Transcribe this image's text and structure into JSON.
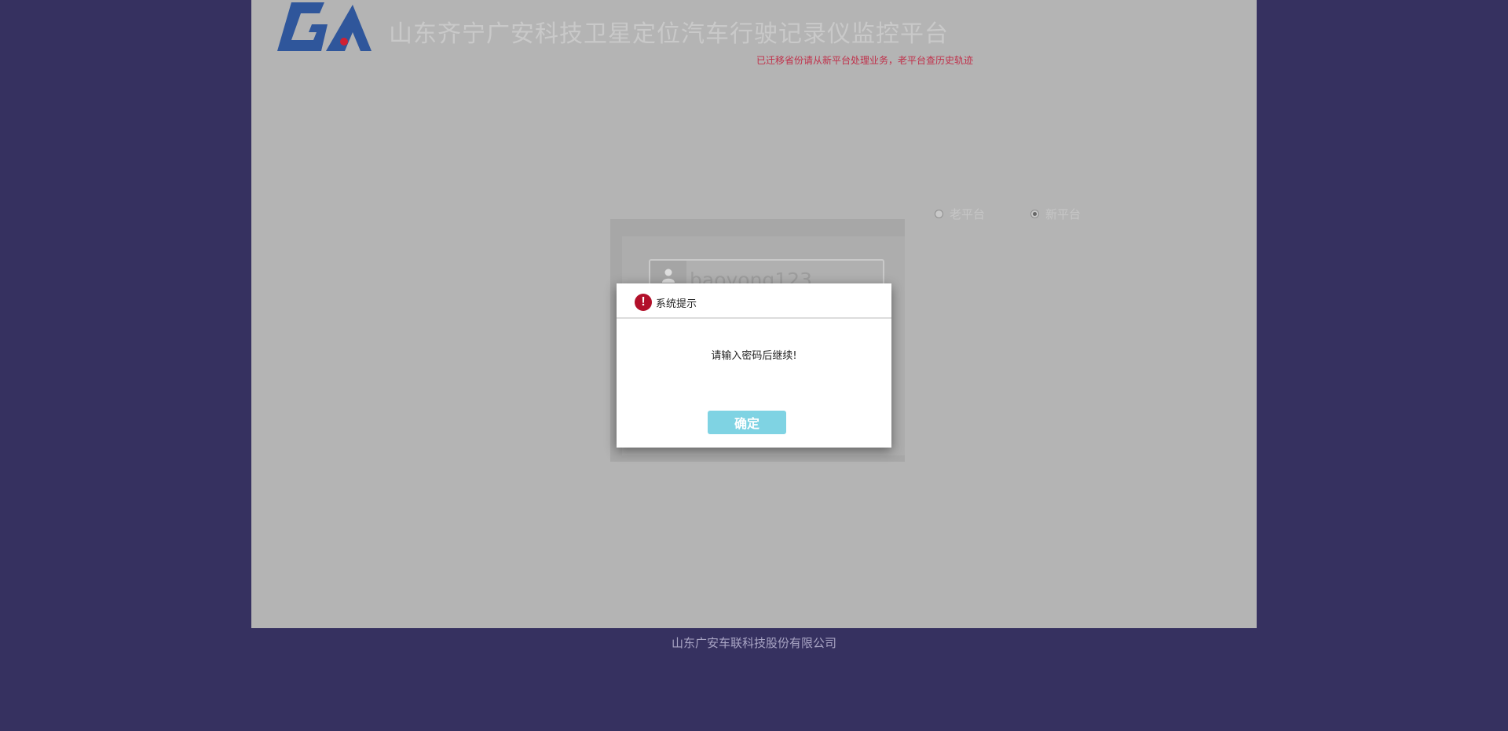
{
  "header": {
    "title": "山东齐宁广安科技卫星定位汽车行驶记录仪监控平台",
    "notice": "已迁移省份请从新平台处理业务，老平台查历史轨迹",
    "logo_icon": "ga-logo"
  },
  "platform_options": [
    {
      "label": "老平台",
      "checked": false
    },
    {
      "label": "新平台",
      "checked": true
    }
  ],
  "login": {
    "username_value": "baoyong123",
    "user_icon": "user-icon"
  },
  "dialog": {
    "title": "系统提示",
    "message": "请输入密码后继续!",
    "confirm_label": "确定",
    "alert_icon": "!"
  },
  "footer": {
    "company": "山东广安车联科技股份有限公司"
  },
  "colors": {
    "background": "#363160",
    "overlay_panel": "#b4b4b4",
    "notice_text": "#c0304a",
    "button": "#7fd3e3",
    "alert_icon": "#b2102a"
  }
}
